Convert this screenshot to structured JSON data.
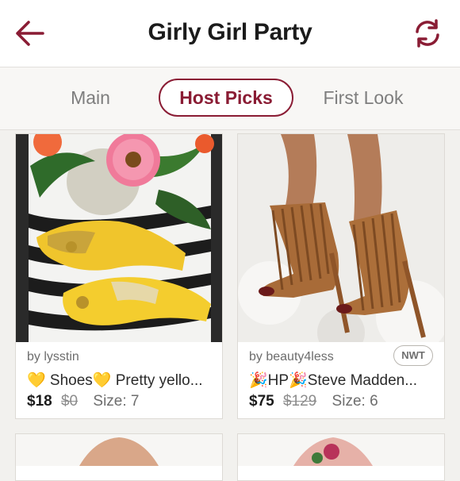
{
  "header": {
    "title": "Girly Girl Party",
    "back_icon": "arrow-left-icon",
    "refresh_icon": "refresh-icon"
  },
  "tabs": [
    {
      "label": "Main",
      "active": false
    },
    {
      "label": "Host Picks",
      "active": true
    },
    {
      "label": "First Look",
      "active": false
    }
  ],
  "colors": {
    "accent": "#8a1c34",
    "text": "#1b1b1b",
    "muted": "#7e7e7e",
    "background": "#f2f1ee"
  },
  "listings": [
    {
      "seller": "by lysstin",
      "title": "💛 Shoes💛  Pretty yello...",
      "price": "$18",
      "original_price": "$0",
      "size": "Size: 7",
      "badge": ""
    },
    {
      "seller": "by beauty4less",
      "title": "🎉HP🎉Steve Madden...",
      "price": "$75",
      "original_price": "$129",
      "size": "Size: 6",
      "badge": "NWT"
    }
  ]
}
